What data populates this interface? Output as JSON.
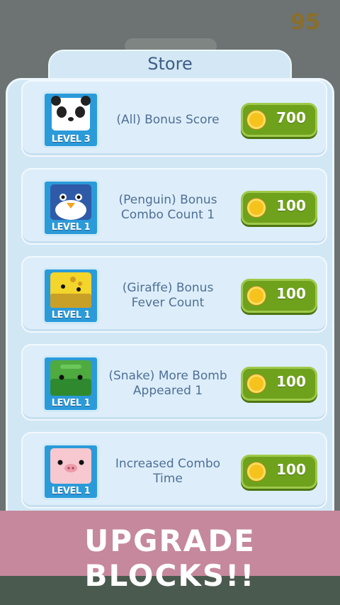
{
  "hud": {
    "score": "95"
  },
  "store": {
    "title": "Store",
    "items": [
      {
        "animal": "panda",
        "level": "LEVEL 3",
        "description": "(All) Bonus Score",
        "price": "700"
      },
      {
        "animal": "penguin",
        "level": "LEVEL 1",
        "description": "(Penguin) Bonus Combo Count 1",
        "price": "100"
      },
      {
        "animal": "giraffe",
        "level": "LEVEL 1",
        "description": "(Giraffe) Bonus Fever Count",
        "price": "100"
      },
      {
        "animal": "snake",
        "level": "LEVEL 1",
        "description": "(Snake) More Bomb Appeared 1",
        "price": "100"
      },
      {
        "animal": "pig",
        "level": "LEVEL 1",
        "description": "Increased Combo Time",
        "price": "100"
      }
    ]
  },
  "banner": {
    "text": "UPGRADE BLOCKS!!"
  },
  "colors": {
    "price_button": "#6fa21c",
    "coin": "#f6c21c",
    "banner": "#c5889c",
    "panel": "#d2e7f4"
  }
}
